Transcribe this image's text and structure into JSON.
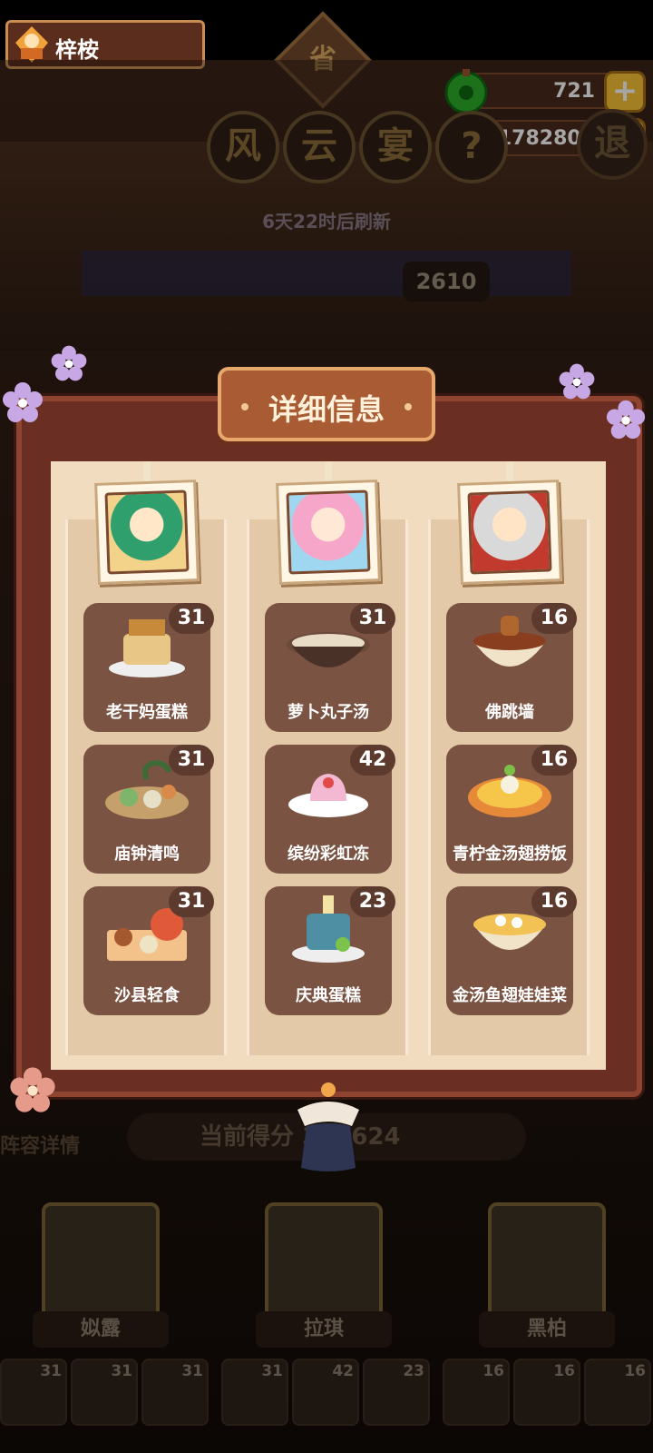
{
  "player": {
    "name": "梓桉"
  },
  "resources": {
    "jade": "721",
    "coins": "1782804"
  },
  "event": {
    "province_badge": "省",
    "title_chars": [
      "风",
      "云",
      "宴"
    ],
    "help_symbol": "?",
    "exit_label": "退",
    "refresh_text": "6天22时后刷新",
    "rank_score": "2610"
  },
  "modal": {
    "title": "详细信息",
    "columns": [
      {
        "dishes": [
          {
            "name": "老干妈蛋糕",
            "count": "31"
          },
          {
            "name": "庙钟清鸣",
            "count": "31"
          },
          {
            "name": "沙县轻食",
            "count": "31"
          }
        ]
      },
      {
        "dishes": [
          {
            "name": "萝卜丸子汤",
            "count": "31"
          },
          {
            "name": "缤纷彩虹冻",
            "count": "42"
          },
          {
            "name": "庆典蛋糕",
            "count": "23"
          }
        ]
      },
      {
        "dishes": [
          {
            "name": "佛跳墙",
            "count": "16"
          },
          {
            "name": "青柠金汤翅捞饭",
            "count": "16"
          },
          {
            "name": "金汤鱼翅娃娃菜",
            "count": "16"
          }
        ]
      }
    ]
  },
  "bottom": {
    "lineup_label": "阵容详情",
    "current_score": "当前得分 362624",
    "chefs": [
      "姒露",
      "拉琪",
      "黑柏"
    ],
    "dish_counts": [
      "31",
      "31",
      "31",
      "31",
      "42",
      "23",
      "16",
      "16",
      "16"
    ]
  },
  "colors": {
    "accent": "#f7c335",
    "panel": "#f1dcc0",
    "frame": "#6a2e22",
    "tile": "#7a5343"
  }
}
